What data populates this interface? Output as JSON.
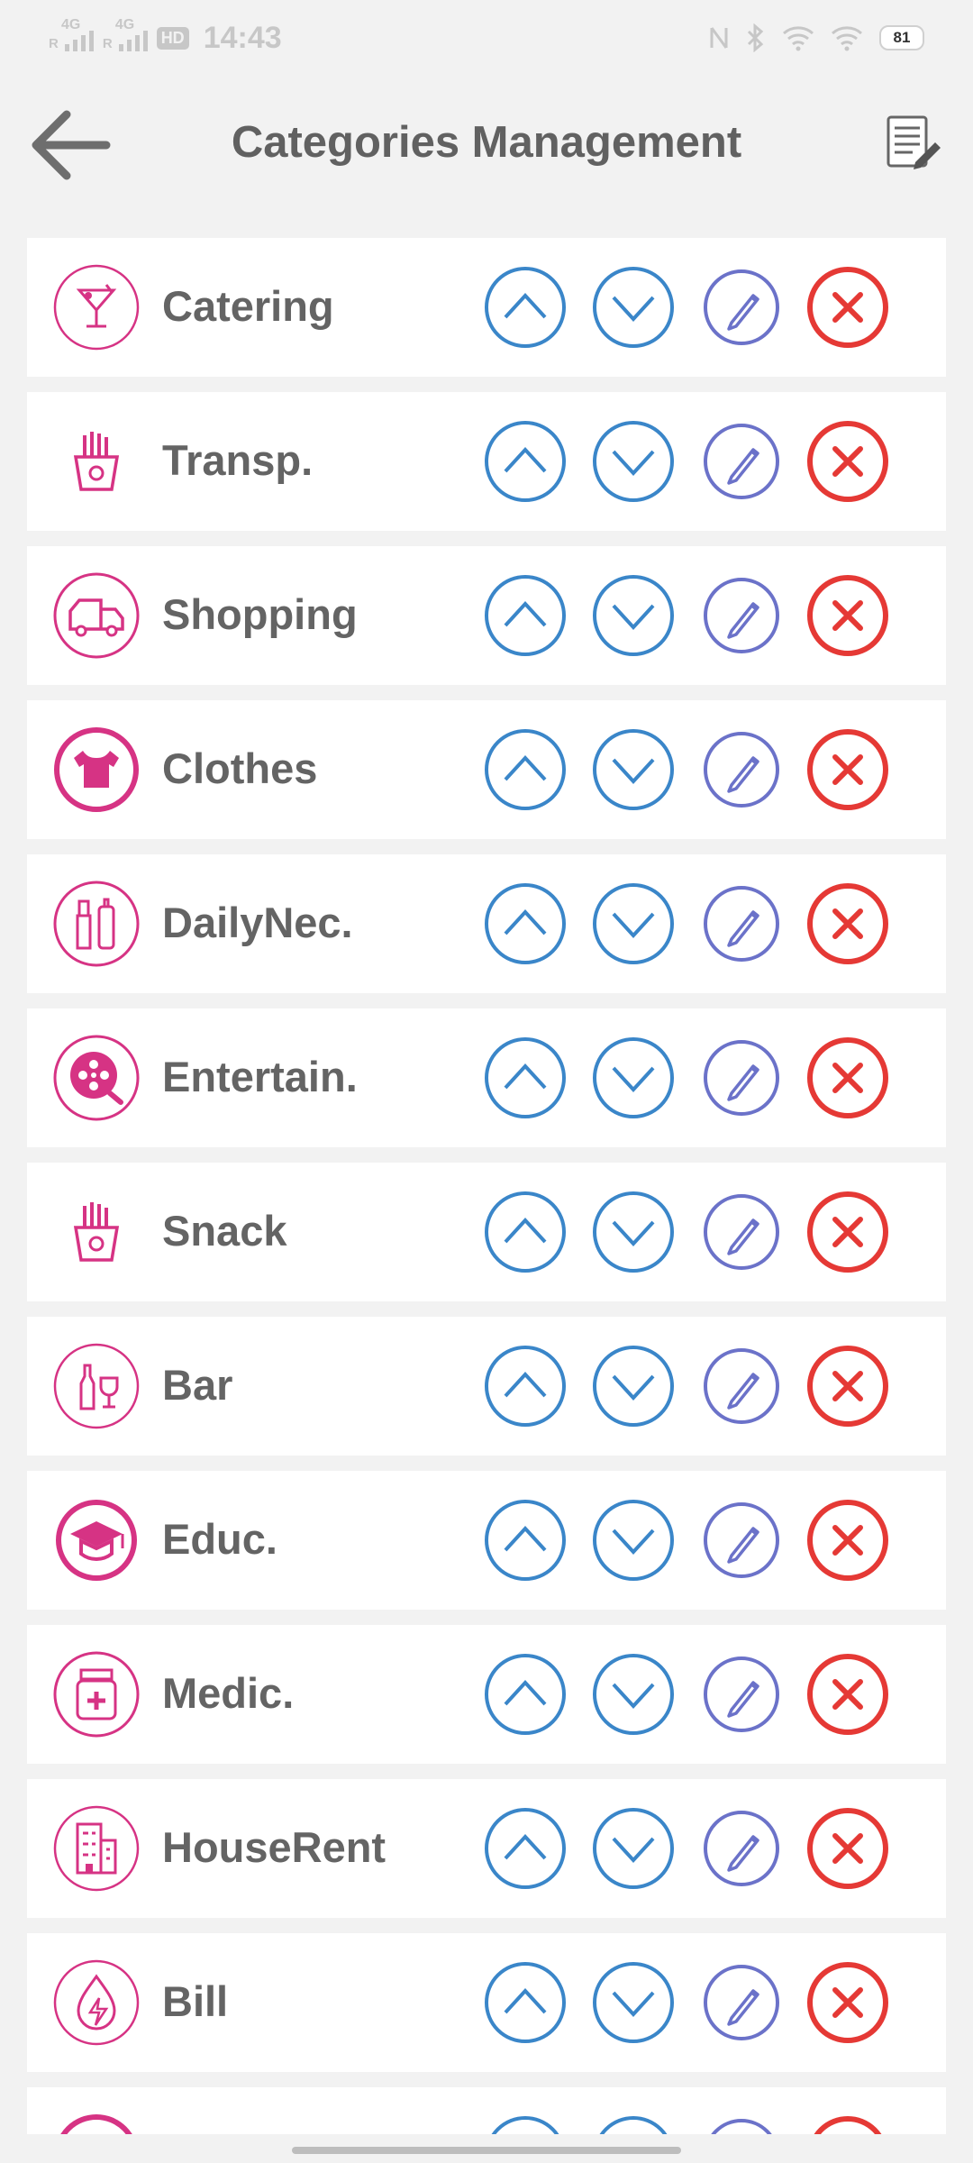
{
  "status_bar": {
    "time": "14:43",
    "battery": "81",
    "network_1": "4G",
    "network_2": "4G",
    "roaming_1": "R",
    "roaming_2": "R",
    "hd_badge": "HD"
  },
  "header": {
    "title": "Categories Management",
    "back_icon": "arrow-left-icon",
    "report_icon": "document-edit-icon"
  },
  "categories": [
    {
      "label": "Catering",
      "icon": "cocktail-icon"
    },
    {
      "label": "Transp.",
      "icon": "fries-icon"
    },
    {
      "label": "Shopping",
      "icon": "delivery-truck-icon"
    },
    {
      "label": "Clothes",
      "icon": "tshirt-icon"
    },
    {
      "label": "DailyNec.",
      "icon": "toiletries-icon"
    },
    {
      "label": "Entertain.",
      "icon": "film-reel-icon"
    },
    {
      "label": "Snack",
      "icon": "fries-icon"
    },
    {
      "label": "Bar",
      "icon": "bottle-glass-icon"
    },
    {
      "label": "Educ.",
      "icon": "graduation-cap-icon"
    },
    {
      "label": "Medic.",
      "icon": "medicine-bottle-icon"
    },
    {
      "label": "HouseRent",
      "icon": "building-icon"
    },
    {
      "label": "Bill",
      "icon": "utility-drop-icon"
    },
    {
      "label": "",
      "icon": "category-icon"
    }
  ],
  "actions": {
    "move_up_icon": "chevron-up-circle-icon",
    "move_down_icon": "chevron-down-circle-icon",
    "edit_icon": "pencil-circle-icon",
    "delete_icon": "x-circle-icon"
  },
  "colors": {
    "category_icon": "#d63384",
    "up_down": "#3a86c9",
    "edit": "#6b72c9",
    "delete": "#e53935",
    "title_text": "#616161",
    "background": "#f2f2f2"
  }
}
